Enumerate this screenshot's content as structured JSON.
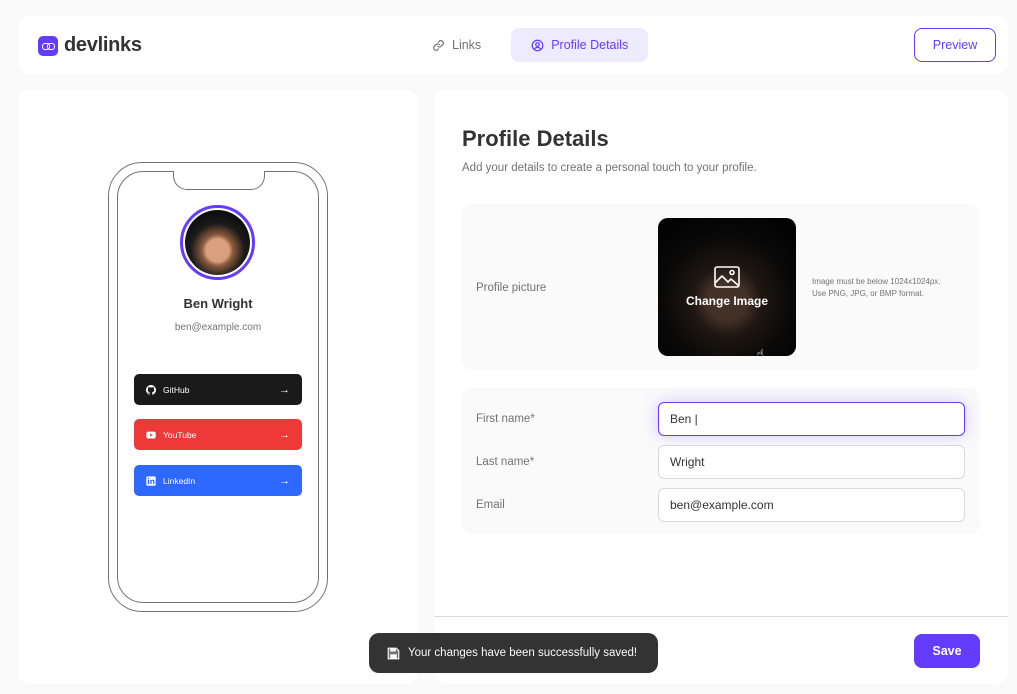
{
  "app": {
    "name": "devlinks"
  },
  "nav": {
    "tabs": [
      {
        "label": "Links",
        "icon": "link-icon",
        "active": false
      },
      {
        "label": "Profile Details",
        "icon": "user-circle-icon",
        "active": true
      }
    ],
    "preview_label": "Preview"
  },
  "phone_preview": {
    "name": "Ben Wright",
    "email": "ben@example.com",
    "links": [
      {
        "platform": "GitHub",
        "icon": "github-icon",
        "color": "#1a1a1a"
      },
      {
        "platform": "YouTube",
        "icon": "youtube-icon",
        "color": "#ee3939"
      },
      {
        "platform": "LinkedIn",
        "icon": "linkedin-icon",
        "color": "#2d68ff"
      }
    ]
  },
  "profile": {
    "title": "Profile Details",
    "subtitle": "Add your details to create a personal touch to your profile.",
    "picture": {
      "label": "Profile picture",
      "change_label": "Change Image",
      "hint_line1": "Image must be below 1024x1024px.",
      "hint_line2": "Use PNG, JPG, or BMP format."
    },
    "fields": {
      "first_name": {
        "label": "First name*",
        "value": "Ben |"
      },
      "last_name": {
        "label": "Last name*",
        "value": "Wright"
      },
      "email": {
        "label": "Email",
        "value": "ben@example.com"
      }
    },
    "save_label": "Save"
  },
  "toast": {
    "message": "Your changes have been successfully saved!"
  },
  "colors": {
    "accent": "#633cff",
    "accent_light": "#efebff",
    "dark": "#333333",
    "muted": "#737373",
    "border": "#d9d9d9",
    "background": "#fafafa"
  }
}
